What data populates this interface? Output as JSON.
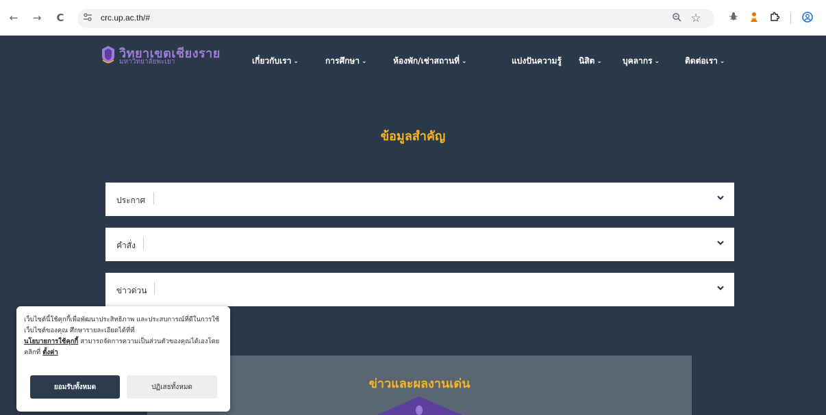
{
  "browser": {
    "url": "crc.up.ac.th/#",
    "back_glyph": "←",
    "forward_glyph": "→",
    "reload_glyph": "C",
    "site_info_glyph": "⚙",
    "zoom_glyph": "⊕",
    "star_glyph": "☆",
    "extension_icons": [
      "bug-icon",
      "person-extension-icon",
      "puzzle-icon"
    ],
    "profile_icon": "profile-icon"
  },
  "site": {
    "logo_title": "วิทยาเขตเชียงราย",
    "logo_subtitle": "มหาวิทยาลัยพะเยา",
    "nav": [
      {
        "label": "เกี่ยวกับเรา",
        "dropdown": true
      },
      {
        "label": "การศึกษา",
        "dropdown": true
      },
      {
        "label": "ห้องพัก/เช่าสถานที่",
        "dropdown": true
      },
      {
        "label": "แบ่งปันความรู้",
        "dropdown": false
      },
      {
        "label": "นิสิต",
        "dropdown": true
      },
      {
        "label": "บุคลากร",
        "dropdown": true
      },
      {
        "label": "ติดต่อเรา",
        "dropdown": true
      }
    ],
    "chevron_glyph": "❯"
  },
  "main": {
    "section_title": "ข้อมูลสำคัญ",
    "accordions": [
      {
        "label": "ประกาศ"
      },
      {
        "label": "คำสั่ง"
      },
      {
        "label": "ข่าวด่วน"
      }
    ],
    "news_title": "ข่าวและผลงานเด่น"
  },
  "cookie": {
    "text_before": "เว็บไซต์นี้ใช้คุกกี้เพื่อพัฒนาประสิทธิภาพ และประสบการณ์ที่ดีในการใช้เว็บไซต์ของคุณ ศึกษารายละเอียดได้ที่ที่",
    "policy_link": "นโยบายการใช้คุกกี้",
    "text_middle": " สามารถจัดการความเป็นส่วนตัวของคุณได้เองโดยคลิกที่ ",
    "settings_link": "ตั้งค่า",
    "accept_label": "ยอมรับทั้งหมด",
    "reject_label": "ปฏิเสธทั้งหมด"
  },
  "colors": {
    "page_bg": "#2b3a4a",
    "accent_gold": "#f7b322",
    "logo_purple": "#9d7bd8",
    "panel_gray": "#5a6773"
  }
}
